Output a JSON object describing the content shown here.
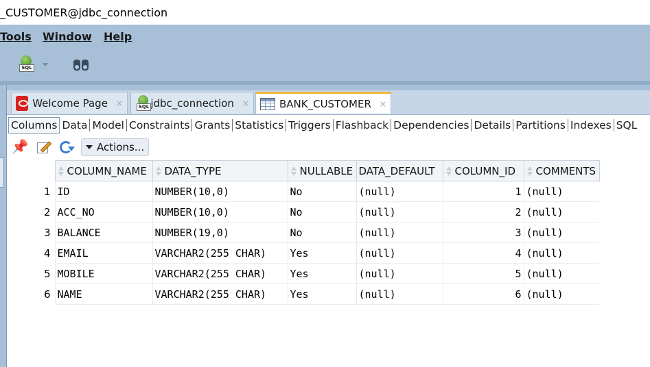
{
  "window": {
    "title": "_CUSTOMER@jdbc_connection"
  },
  "menu": {
    "tools": "Tools",
    "window": "Window",
    "help": "Help"
  },
  "toolbar": {
    "sql_icon_label": "SQL"
  },
  "doc_tabs": [
    {
      "label": "Welcome Page",
      "icon": "oracle-icon"
    },
    {
      "label": "jdbc_connection",
      "icon": "sql-connection-icon"
    },
    {
      "label": "BANK_CUSTOMER",
      "icon": "table-icon",
      "active": true
    }
  ],
  "close_glyph": "×",
  "sub_tabs": [
    "Columns",
    "Data",
    "Model",
    "Constraints",
    "Grants",
    "Statistics",
    "Triggers",
    "Flashback",
    "Dependencies",
    "Details",
    "Partitions",
    "Indexes",
    "SQL"
  ],
  "actions": {
    "label": "Actions..."
  },
  "grid": {
    "columns": [
      "COLUMN_NAME",
      "DATA_TYPE",
      "NULLABLE",
      "DATA_DEFAULT",
      "COLUMN_ID",
      "COMMENTS"
    ],
    "rows": [
      {
        "n": "1",
        "column_name": "ID",
        "data_type": "NUMBER(10,0)",
        "nullable": "No",
        "data_default": "(null)",
        "column_id": "1",
        "comments": "(null)"
      },
      {
        "n": "2",
        "column_name": "ACC_NO",
        "data_type": "NUMBER(10,0)",
        "nullable": "No",
        "data_default": "(null)",
        "column_id": "2",
        "comments": "(null)"
      },
      {
        "n": "3",
        "column_name": "BALANCE",
        "data_type": "NUMBER(19,0)",
        "nullable": "No",
        "data_default": "(null)",
        "column_id": "3",
        "comments": "(null)"
      },
      {
        "n": "4",
        "column_name": "EMAIL",
        "data_type": "VARCHAR2(255 CHAR)",
        "nullable": "Yes",
        "data_default": "(null)",
        "column_id": "4",
        "comments": "(null)"
      },
      {
        "n": "5",
        "column_name": "MOBILE",
        "data_type": "VARCHAR2(255 CHAR)",
        "nullable": "Yes",
        "data_default": "(null)",
        "column_id": "5",
        "comments": "(null)"
      },
      {
        "n": "6",
        "column_name": "NAME",
        "data_type": "VARCHAR2(255 CHAR)",
        "nullable": "Yes",
        "data_default": "(null)",
        "column_id": "6",
        "comments": "(null)"
      }
    ]
  },
  "colors": {
    "chrome": "#a7c0d7",
    "active_tab_accent": "#f0b840",
    "oracle_red": "#d8211e"
  }
}
